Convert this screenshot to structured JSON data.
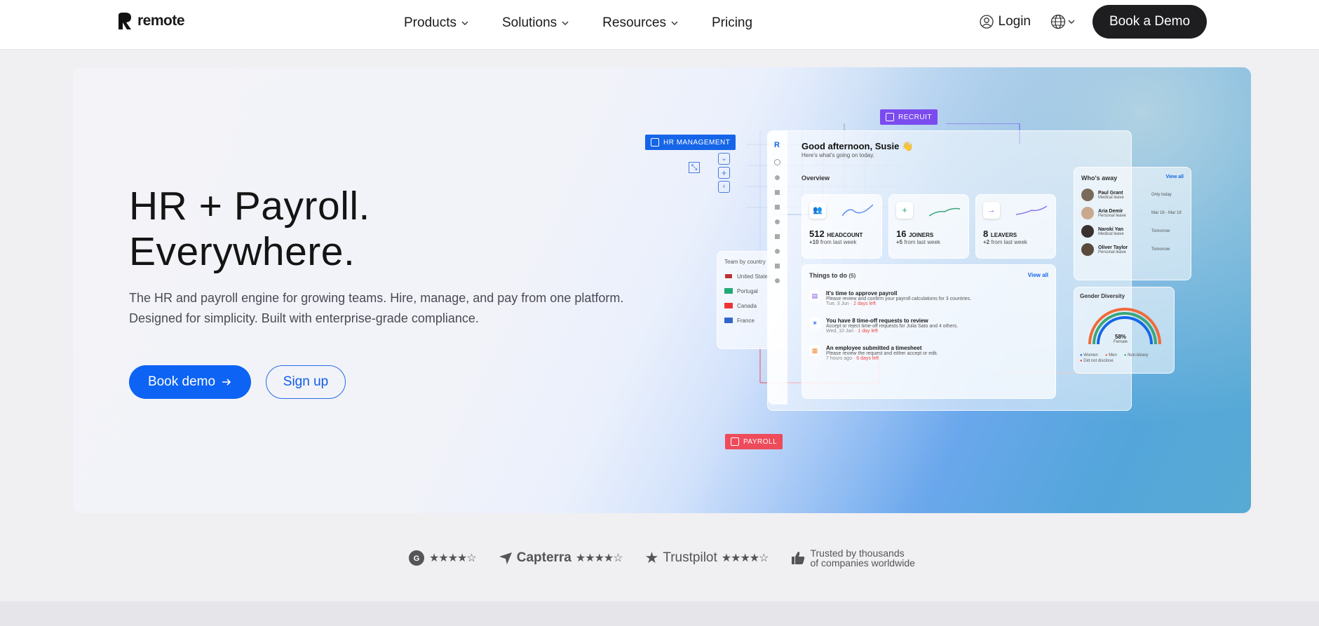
{
  "nav": {
    "brand": "remote",
    "menu": [
      {
        "label": "Products",
        "has_dropdown": true
      },
      {
        "label": "Solutions",
        "has_dropdown": true
      },
      {
        "label": "Resources",
        "has_dropdown": true
      },
      {
        "label": "Pricing",
        "has_dropdown": false
      }
    ],
    "login_label": "Login",
    "demo_label": "Book a Demo"
  },
  "hero": {
    "title_line1": "HR + Payroll.",
    "title_line2": "Everywhere.",
    "subtitle": "The HR and payroll engine for growing teams. Hire, manage, and pay from one platform. Designed for simplicity. Built with enterprise-grade compliance.",
    "primary_cta": "Book demo",
    "secondary_cta": "Sign up"
  },
  "mockup": {
    "tags": {
      "hr": "HR MANAGEMENT",
      "recruit": "RECRUIT",
      "payroll": "PAYROLL"
    },
    "greeting": "Good afternoon, Susie 👋",
    "greeting_sub": "Here's what's going on today.",
    "overview_label": "Overview",
    "stats": [
      {
        "value": "512",
        "label": "HEADCOUNT",
        "delta": "+10",
        "delta_note": "from last week"
      },
      {
        "value": "16",
        "label": "JOINERS",
        "delta": "+5",
        "delta_note": "from last week"
      },
      {
        "value": "8",
        "label": "LEAVERS",
        "delta": "+2",
        "delta_note": "from last week"
      }
    ],
    "todo_title": "Things to do",
    "todo_count": "(5)",
    "view_all": "View all",
    "todos": [
      {
        "title": "It's time to approve payroll",
        "desc": "Please review and confirm your payroll calculations for 3 countries.",
        "meta": "Tue, 3 Jun",
        "due": "2 days left"
      },
      {
        "title": "You have 8 time-off requests to review",
        "desc": "Accept or reject time-off requests for Julia Sato and 4 others.",
        "meta": "Wed, 10 Jan",
        "due": "1 day left"
      },
      {
        "title": "An employee submitted a timesheet",
        "desc": "Please review the request and either accept or edit.",
        "meta": "7 hours ago",
        "due": "6 days left"
      }
    ],
    "team_by_country": "Team by country",
    "countries": [
      "United States",
      "Portugal",
      "Canada",
      "France"
    ],
    "whos_away": "Who's away",
    "away_view_all": "View all",
    "away": [
      {
        "name": "Paul Grant",
        "reason": "Medical leave",
        "when": "Only today"
      },
      {
        "name": "Aria Demir",
        "reason": "Personal leave",
        "when": "Mar 16 - Mar 18"
      },
      {
        "name": "Naroki Yan",
        "reason": "Medical leave",
        "when": "Tomorrow"
      },
      {
        "name": "Oliver Taylor",
        "reason": "Personal leave",
        "when": "Tomorrow"
      }
    ],
    "gender_title": "Gender Diversity",
    "gender_pct": "58%",
    "gender_pct_label": "Female",
    "gender_legend": [
      "Women",
      "Men",
      "Non-binary",
      "Did not disclose"
    ]
  },
  "ratings": {
    "capterra": "Capterra",
    "trustpilot": "Trustpilot",
    "trusted_line1": "Trusted by thousands",
    "trusted_line2": "of companies worldwide"
  },
  "colors": {
    "primary": "#0d63f4",
    "dark_button": "#1e1e20",
    "hr_tag": "#1565e8",
    "recruit_tag": "#7b4bf0",
    "payroll_tag": "#ee4b5b"
  }
}
